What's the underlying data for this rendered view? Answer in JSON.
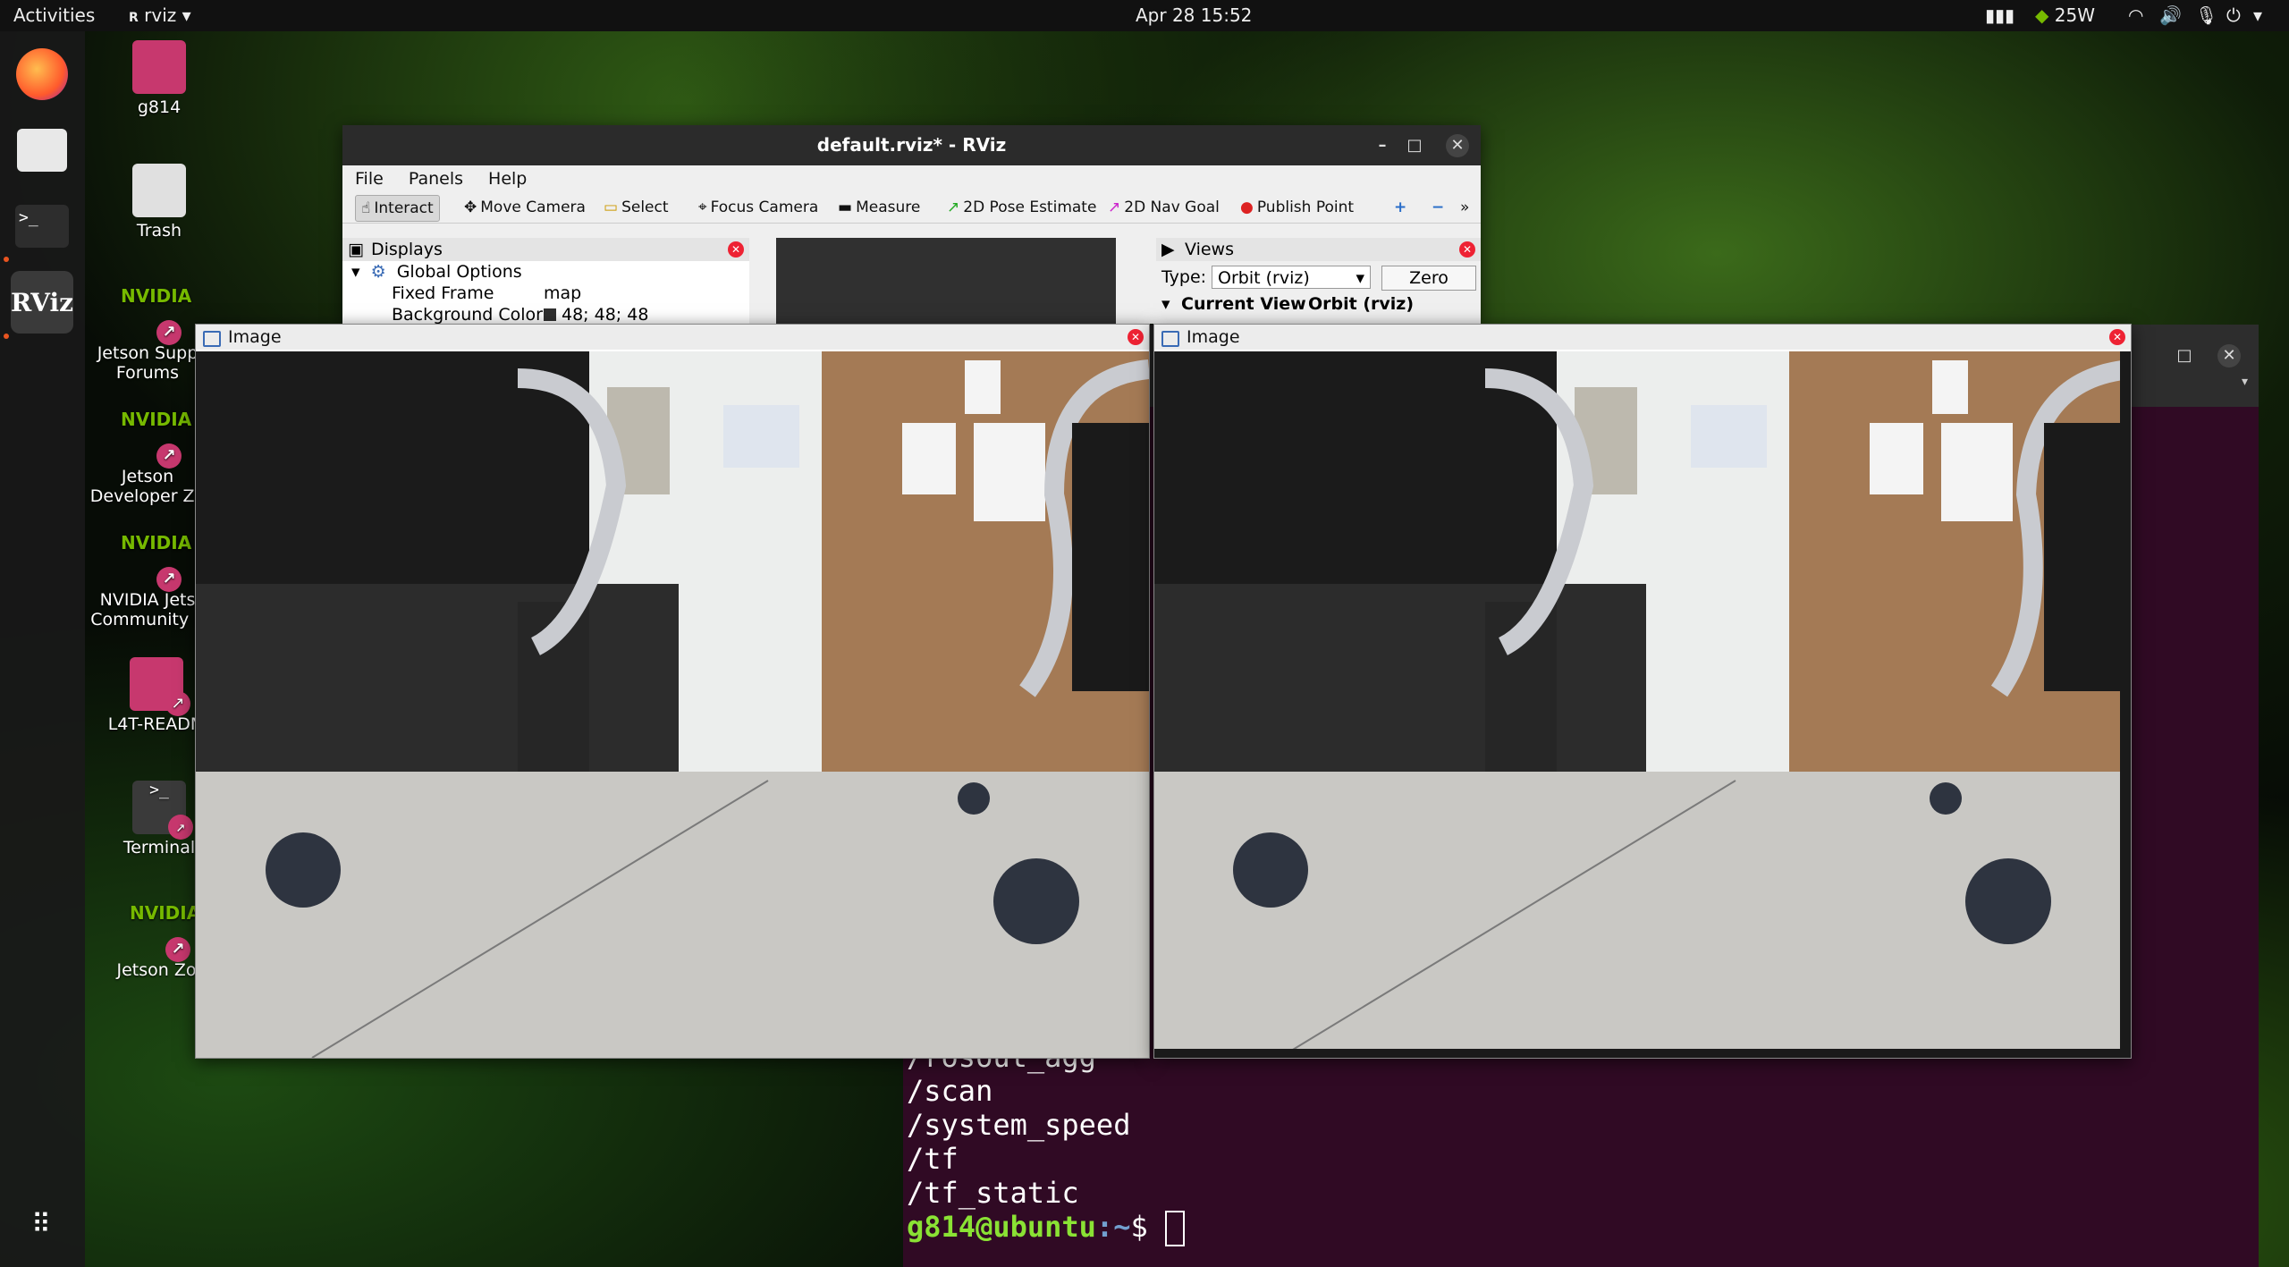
{
  "topbar": {
    "activities": "Activities",
    "app_name": "rviz",
    "datetime": "Apr 28  15:52",
    "power": "25W"
  },
  "desktop": {
    "icons": [
      {
        "label": "g814"
      },
      {
        "label": "Trash"
      },
      {
        "label": "Jetson Supp\nForums"
      },
      {
        "label": "Jetson\nDeveloper Zo"
      },
      {
        "label": "NVIDIA Jets\nCommunity P"
      },
      {
        "label": "L4T-READM"
      },
      {
        "label": "Terminal"
      },
      {
        "label": "Jetson Zo"
      }
    ]
  },
  "rviz": {
    "title": "default.rviz* - RViz",
    "menu": [
      "File",
      "Panels",
      "Help"
    ],
    "tools": [
      "Interact",
      "Move Camera",
      "Select",
      "Focus Camera",
      "Measure",
      "2D Pose Estimate",
      "2D Nav Goal",
      "Publish Point"
    ],
    "displays": {
      "header": "Displays",
      "global_options": "Global Options",
      "fixed_frame_label": "Fixed Frame",
      "fixed_frame_value": "map",
      "bg_color_label": "Background Color",
      "bg_color_value": "48; 48; 48"
    },
    "views": {
      "header": "Views",
      "type_label": "Type:",
      "type_value": "Orbit (rviz)",
      "zero_button": "Zero",
      "current_view": "Current View",
      "current_view_value": "Orbit (rviz)"
    }
  },
  "image_windows": [
    {
      "title": "Image"
    },
    {
      "title": "Image"
    }
  ],
  "terminal": {
    "lines": [
      "/rosout_agg",
      "/scan",
      "/system_speed",
      "/tf",
      "/tf_static"
    ],
    "prompt_user": "g814@ubuntu",
    "prompt_path": ":~",
    "prompt_symbol": "$ "
  }
}
